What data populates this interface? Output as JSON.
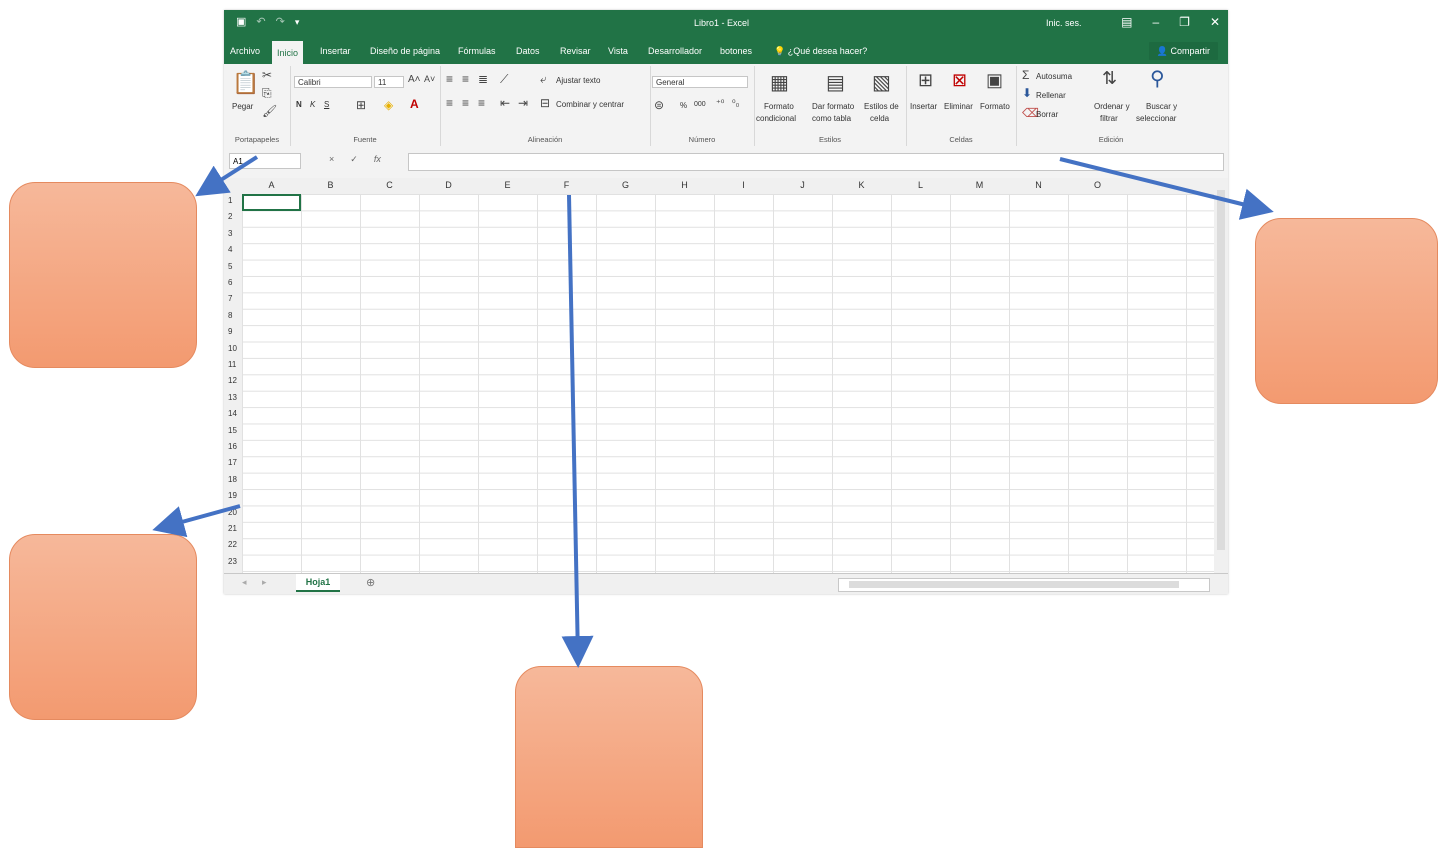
{
  "window": {
    "title": "Libro1 - Excel",
    "user": "Inic. ses."
  },
  "quick_access": {
    "save_icon": "save-icon",
    "undo_icon": "undo-icon",
    "redo_icon": "redo-icon"
  },
  "tabs": [
    {
      "label": "Archivo"
    },
    {
      "label": "Inicio"
    },
    {
      "label": "Insertar"
    },
    {
      "label": "Diseño de página"
    },
    {
      "label": "Fórmulas"
    },
    {
      "label": "Datos"
    },
    {
      "label": "Revisar"
    },
    {
      "label": "Vista"
    },
    {
      "label": "Desarrollador"
    },
    {
      "label": "botones"
    }
  ],
  "tell_me": "¿Qué desea hacer?",
  "share": "Compartir",
  "ribbon": {
    "clipboard": {
      "paste": "Pegar",
      "label": "Portapapeles"
    },
    "font": {
      "name": "Calibri",
      "size": "11",
      "bold": "N",
      "italic": "K",
      "underline": "S",
      "label": "Fuente"
    },
    "alignment": {
      "wrap": "Ajustar texto",
      "merge": "Combinar y centrar",
      "label": "Alineación"
    },
    "number": {
      "format": "General",
      "percent": "%",
      "thousands": "000",
      "label": "Número"
    },
    "styles": {
      "cond1": "Formato",
      "cond2": "condicional",
      "table1": "Dar formato",
      "table2": "como tabla",
      "cell1": "Estilos de",
      "cell2": "celda",
      "label": "Estilos"
    },
    "cells": {
      "insert": "Insertar",
      "delete": "Eliminar",
      "format": "Formato",
      "label": "Celdas"
    },
    "editing": {
      "autosum": "Autosuma",
      "fill": "Rellenar",
      "clear": "Borrar",
      "sort1": "Ordenar y",
      "sort2": "filtrar",
      "find1": "Buscar y",
      "find2": "seleccionar",
      "label": "Edición"
    }
  },
  "formula_bar": {
    "name_box": "A1",
    "cancel": "×",
    "enter": "✓",
    "fx": "fx"
  },
  "columns": [
    "A",
    "B",
    "C",
    "D",
    "E",
    "F",
    "G",
    "H",
    "I",
    "J",
    "K",
    "L",
    "M",
    "N",
    "O"
  ],
  "rows": [
    "1",
    "2",
    "3",
    "4",
    "5",
    "6",
    "7",
    "8",
    "9",
    "10",
    "11",
    "12",
    "13",
    "14",
    "15",
    "16",
    "17",
    "18",
    "19",
    "20",
    "21",
    "22",
    "23"
  ],
  "sheet": {
    "name": "Hoja1",
    "add": "⊕"
  }
}
